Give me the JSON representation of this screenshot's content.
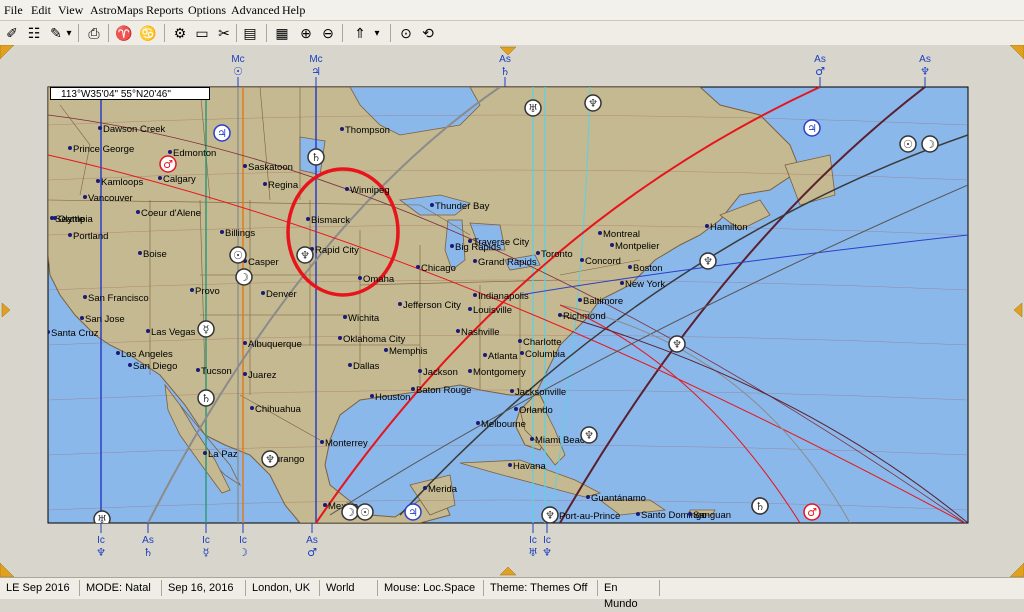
{
  "menu": [
    "File",
    "Edit",
    "View",
    "AstroMaps",
    "Reports",
    "Options",
    "Advanced",
    "Help"
  ],
  "toolbar": {
    "icons": [
      "pencil-icon",
      "edit-chart-icon",
      "notes-icon",
      "dropdown-icon",
      "print-icon",
      "zodiac-icon",
      "aspects-icon",
      "gear-icon",
      "window-icon",
      "tools-icon",
      "monitor-icon",
      "map-icon",
      "zoom-in-icon",
      "zoom-out-icon",
      "ls-icon",
      "dropdown-icon",
      "target-icon",
      "refresh-icon"
    ],
    "glyphs": [
      "✐",
      "☷",
      "✎",
      "▾",
      "⎙",
      "♈",
      "♋",
      "⚙",
      "▭",
      "✂",
      "▤",
      "▦",
      "⊕",
      "⊖",
      "⇑",
      "▾",
      "⊙",
      "⟲"
    ]
  },
  "coord_display": "113°W35'04\"    55°N20'46\"",
  "top_labels": [
    {
      "t1": "Mc",
      "t2": "☉"
    },
    {
      "t1": "Mc",
      "t2": "♃"
    },
    {
      "t1": "As",
      "t2": "♄"
    },
    {
      "t1": "As",
      "t2": "♂"
    },
    {
      "t1": "As",
      "t2": "♆"
    }
  ],
  "bottom_labels": [
    {
      "t1": "Ic",
      "t2": "♆"
    },
    {
      "t1": "As",
      "t2": "♄"
    },
    {
      "t1": "Ic",
      "t2": "☿"
    },
    {
      "t1": "Ic",
      "t2": "☽"
    },
    {
      "t1": "As",
      "t2": "♂"
    },
    {
      "t1": "Ic",
      "t2": "♅"
    },
    {
      "t1": "Ic",
      "t2": "♆"
    }
  ],
  "cities": [
    "Dawson Creek",
    "Prince George",
    "Edmonton",
    "Calgary",
    "Kamloops",
    "Vancouver",
    "Seattle",
    "Olympia",
    "Portland",
    "Coeur d'Alene",
    "Billings",
    "Casper",
    "Saskatoon",
    "Regina",
    "Thompson",
    "Winnipeg",
    "Bismarck",
    "Rapid City",
    "Omaha",
    "Thunder Bay",
    "Big Rapids",
    "Traverse City",
    "Grand Rapids",
    "Chicago",
    "Toronto",
    "Montreal",
    "Montpelier",
    "Concord",
    "Boston",
    "Hamilton",
    "New York",
    "Baltimore",
    "Richmond",
    "Indianapolis",
    "Louisville",
    "Nashville",
    "Jefferson City",
    "Wichita",
    "Oklahoma City",
    "Memphis",
    "Charlotte",
    "Columbia",
    "Atlanta",
    "Montgomery",
    "Jackson",
    "Dallas",
    "Baton Rouge",
    "Houston",
    "Jacksonville",
    "Orlando",
    "Melbourne",
    "Miami Beach",
    "Havana",
    "Merida",
    "Guantanamo",
    "Port-au-Prince",
    "Santo Domingo",
    "San Juan",
    "Mexico",
    "Monterrey",
    "Durango",
    "La Paz",
    "Chihuahua",
    "Juarez",
    "Tucson",
    "Albuquerque",
    "Denver",
    "Provo",
    "Boise",
    "San Francisco",
    "San Jose",
    "Santa Cruz",
    "Las Vegas",
    "Los Angeles",
    "San Diego"
  ],
  "city_display": {
    "San Juan": "Sanguan",
    "Santo Domingo": "Santo Domingo",
    "Port-au-Prince": "Port-au-Prince",
    "Guantanamo": "Guantánamo",
    "Mexico": "Mexico",
    "Monterrey": "Monterrey"
  },
  "planet_markers": [
    {
      "glyph": "♅"
    },
    {
      "glyph": "♆"
    },
    {
      "glyph": "♃"
    },
    {
      "glyph": "☉"
    },
    {
      "glyph": "☽"
    },
    {
      "glyph": "♄"
    },
    {
      "glyph": "♂"
    },
    {
      "glyph": "♃"
    },
    {
      "glyph": "♆"
    },
    {
      "glyph": "☉"
    },
    {
      "glyph": "☽"
    },
    {
      "glyph": "☿"
    },
    {
      "glyph": "♄"
    },
    {
      "glyph": "♆"
    },
    {
      "glyph": "♆"
    },
    {
      "glyph": "♆"
    },
    {
      "glyph": "♆"
    },
    {
      "glyph": "♆"
    },
    {
      "glyph": "☽"
    },
    {
      "glyph": "☉"
    },
    {
      "glyph": "♃"
    },
    {
      "glyph": "♅"
    },
    {
      "glyph": "♆"
    },
    {
      "glyph": "♄"
    },
    {
      "glyph": "♂"
    }
  ],
  "status": [
    "LE Sep 2016",
    "MODE: Natal",
    "Sep 16, 2016",
    "London, UK",
    "World",
    "Mouse: Loc.Space",
    "Theme: Themes Off",
    "En Mundo"
  ],
  "colors": {
    "ocean": "#8bb8ea",
    "land": "#c4b990",
    "border": "#7e5f3c",
    "highlight_circle": "#e8141c",
    "mars_line": "#e8141c",
    "jupiter_line": "#2a3fc8",
    "saturn_line": "#8b8b8b",
    "uranus_line": "#5fd0e0",
    "mercury_line": "#2d9a7a",
    "moon_line": "#e07a20",
    "pluto_line": "#5a2030"
  }
}
